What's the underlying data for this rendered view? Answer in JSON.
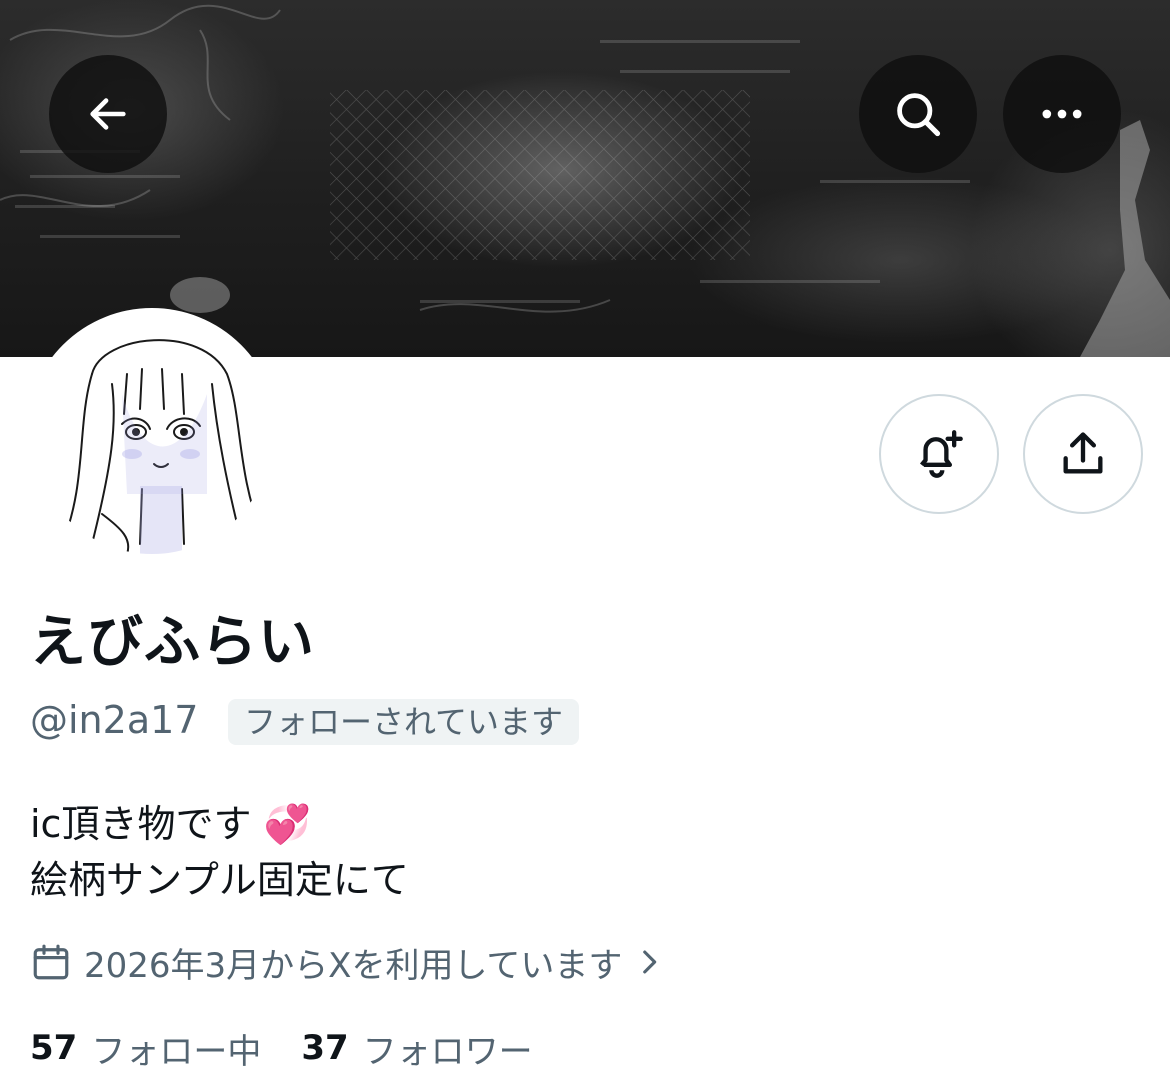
{
  "profile": {
    "display_name": "えびふらい",
    "handle": "@in2a17",
    "follows_you_badge": "フォローされています",
    "bio_line1": "ic頂き物です",
    "bio_emoji": "💞",
    "bio_line2": "絵柄サンプル固定にて",
    "joined_text": "2026年3月からXを利用しています",
    "following_count": "57",
    "following_label": "フォロー中",
    "followers_count": "37",
    "followers_label": "フォロワー"
  },
  "icons": {
    "back": "back-arrow-icon",
    "search": "search-icon",
    "more": "more-dots-icon",
    "notify": "bell-plus-icon",
    "share": "share-upload-icon",
    "calendar": "calendar-icon",
    "chevron": "chevron-right-icon"
  },
  "colors": {
    "secondary_text": "#536471",
    "badge_bg": "#eff3f4",
    "border": "#cfd9de",
    "emoji_pink": "#ff4fa3"
  }
}
